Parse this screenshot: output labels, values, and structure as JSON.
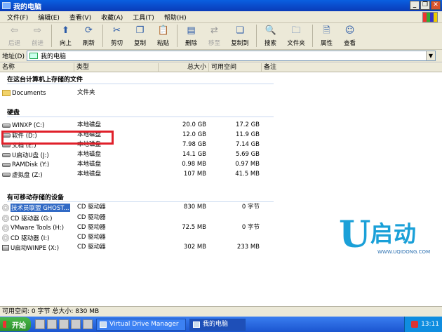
{
  "window": {
    "title": "我的电脑",
    "controls": [
      "_",
      "❐",
      "✕"
    ]
  },
  "menu": [
    "文件(F)",
    "编辑(E)",
    "查看(V)",
    "收藏(A)",
    "工具(T)",
    "帮助(H)"
  ],
  "toolbar": [
    {
      "label": "后退",
      "icon": "back-arrow-icon",
      "glyph": "⇦",
      "disabled": true,
      "dropdown": true
    },
    {
      "label": "前进",
      "icon": "forward-arrow-icon",
      "glyph": "⇨",
      "disabled": true,
      "dropdown": true
    },
    {
      "label": "向上",
      "icon": "up-arrow-icon",
      "glyph": "⬆"
    },
    {
      "label": "刷新",
      "icon": "refresh-icon",
      "glyph": "⟳"
    },
    {
      "label": "剪切",
      "icon": "scissors-icon",
      "glyph": "✂"
    },
    {
      "label": "复制",
      "icon": "copy-icon",
      "glyph": "❐"
    },
    {
      "label": "粘贴",
      "icon": "paste-icon",
      "glyph": "📋"
    },
    {
      "label": "删除",
      "icon": "delete-icon",
      "glyph": "▤"
    },
    {
      "label": "移至",
      "icon": "move-to-icon",
      "glyph": "⇄",
      "disabled": true
    },
    {
      "label": "复制到",
      "icon": "copy-to-icon",
      "glyph": "❏"
    },
    {
      "label": "搜索",
      "icon": "search-icon",
      "glyph": "🔍"
    },
    {
      "label": "文件夹",
      "icon": "folder-icon",
      "glyph": "🗀"
    },
    {
      "label": "属性",
      "icon": "properties-icon",
      "glyph": "🗎"
    },
    {
      "label": "查看",
      "icon": "view-icon",
      "glyph": "☺",
      "dropdown": true
    }
  ],
  "address": {
    "label": "地址(D)",
    "value": "我的电脑"
  },
  "columns": [
    "名称",
    "类型",
    "总大小",
    "可用空间",
    "备注"
  ],
  "groups": [
    {
      "title": "在这台计算机上存储的文件",
      "items": [
        {
          "name": "Documents",
          "type": "文件夹",
          "size": "",
          "free": "",
          "icon": "folder"
        }
      ]
    },
    {
      "title": "硬盘",
      "items": [
        {
          "name": "WINXP (C:)",
          "type": "本地磁盘",
          "size": "20.0 GB",
          "free": "17.2 GB",
          "icon": "drive"
        },
        {
          "name": "软件 (D:)",
          "type": "本地磁盘",
          "size": "12.0 GB",
          "free": "11.9 GB",
          "icon": "drive"
        },
        {
          "name": "文档 (E:)",
          "type": "本地磁盘",
          "size": "7.98 GB",
          "free": "7.14 GB",
          "icon": "drive"
        },
        {
          "name": "U启动U盘 (J:)",
          "type": "本地磁盘",
          "size": "14.1 GB",
          "free": "5.69 GB",
          "icon": "drive"
        },
        {
          "name": "RAMDisk (Y:)",
          "type": "本地磁盘",
          "size": "0.98 MB",
          "free": "0.97 MB",
          "icon": "drive"
        },
        {
          "name": "虚拟盘 (Z:)",
          "type": "本地磁盘",
          "size": "107 MB",
          "free": "41.5 MB",
          "icon": "drive"
        }
      ]
    },
    {
      "title": "有可移动存储的设备",
      "items": [
        {
          "name": "技术员联盟 GHOST...",
          "type": "CD 驱动器",
          "size": "830 MB",
          "free": "0 字节",
          "icon": "cd",
          "selected": true
        },
        {
          "name": "CD 驱动器 (G:)",
          "type": "CD 驱动器",
          "size": "",
          "free": "",
          "icon": "cd"
        },
        {
          "name": "VMware Tools (H:)",
          "type": "CD 驱动器",
          "size": "72.5 MB",
          "free": "0 字节",
          "icon": "cd"
        },
        {
          "name": "CD 驱动器 (I:)",
          "type": "CD 驱动器",
          "size": "",
          "free": "",
          "icon": "cd"
        },
        {
          "name": "U启动WINPE (X:)",
          "type": "CD 驱动器",
          "size": "302 MB",
          "free": "233 MB",
          "icon": "usb"
        }
      ]
    }
  ],
  "logo": {
    "mark": "U",
    "name": "启动",
    "url": "WWW.UQIDONG.COM",
    "color": "#1aa0d8"
  },
  "status": "可用空间: 0 字节 总大小: 830 MB",
  "taskbar": {
    "start": "开始",
    "tasks": [
      "Virtual Drive Manager",
      "我的电脑"
    ],
    "clock": "13:11"
  }
}
